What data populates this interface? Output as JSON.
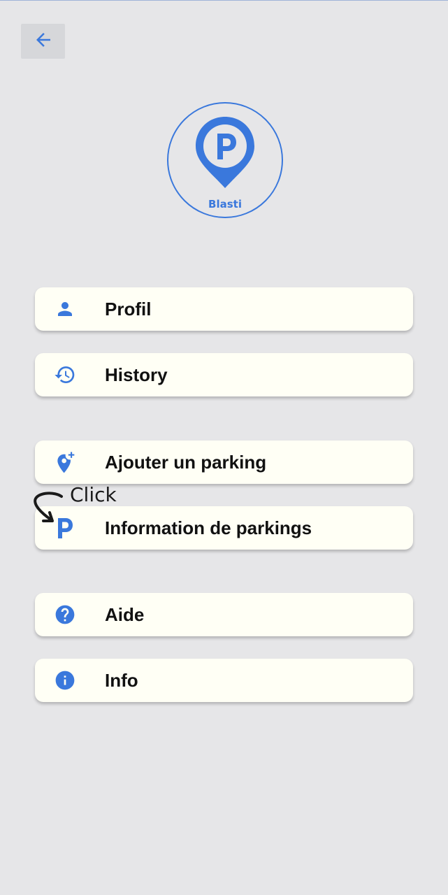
{
  "header": {
    "back_icon": "arrow-left-icon"
  },
  "logo": {
    "text": "Blasti",
    "icon": "parking-pin-icon"
  },
  "menu": {
    "items": [
      {
        "label": "Profil",
        "icon": "person-icon"
      },
      {
        "label": "History",
        "icon": "history-icon"
      },
      {
        "label": "Ajouter un parking",
        "icon": "add-location-icon"
      },
      {
        "label": "Information de parkings",
        "icon": "parking-p-icon"
      },
      {
        "label": "Aide",
        "icon": "help-icon"
      },
      {
        "label": "Info",
        "icon": "info-icon"
      }
    ]
  },
  "annotation": {
    "text": "Click"
  },
  "colors": {
    "accent": "#3a78dc",
    "background": "#e6e6e8",
    "card": "#fffff5"
  }
}
